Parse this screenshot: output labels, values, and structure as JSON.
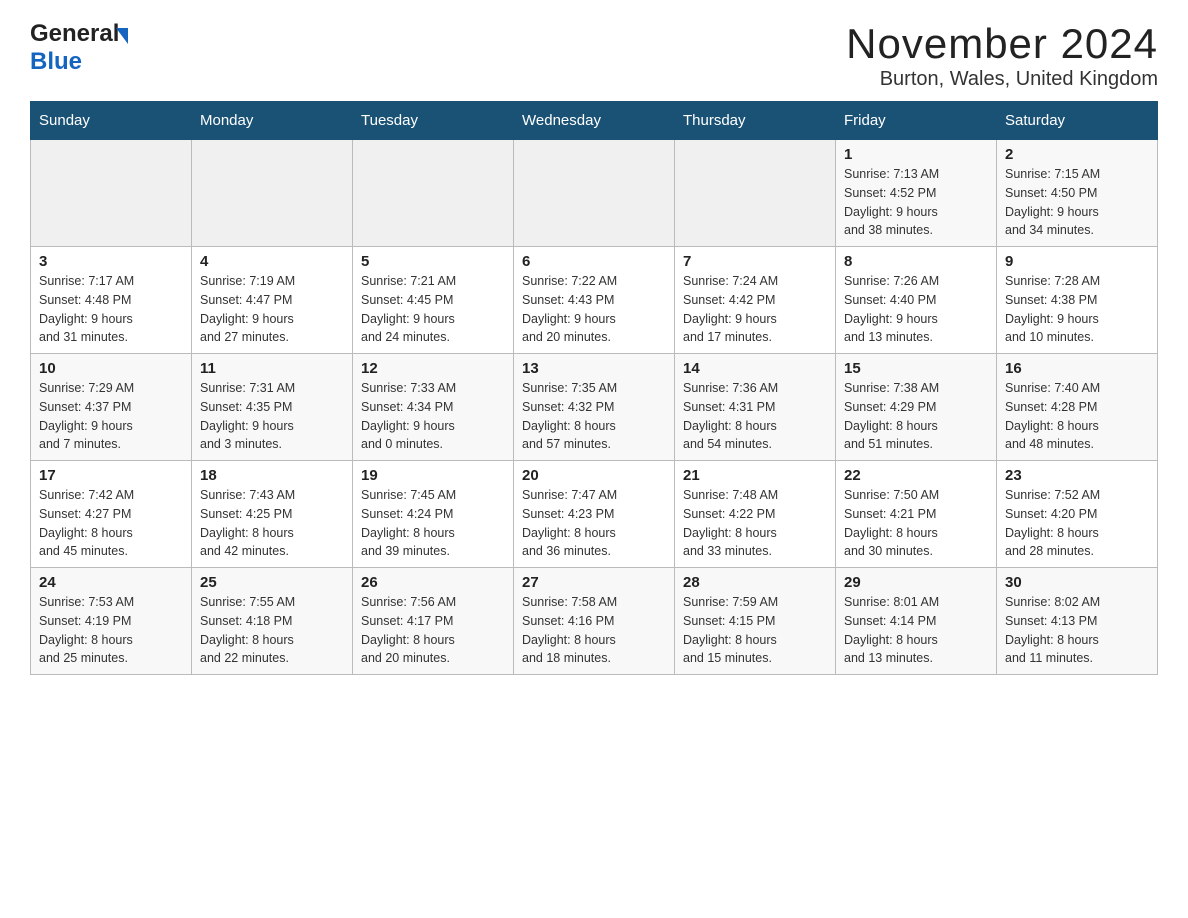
{
  "logo": {
    "general": "General",
    "blue": "Blue"
  },
  "title": "November 2024",
  "subtitle": "Burton, Wales, United Kingdom",
  "days_of_week": [
    "Sunday",
    "Monday",
    "Tuesday",
    "Wednesday",
    "Thursday",
    "Friday",
    "Saturday"
  ],
  "weeks": [
    {
      "days": [
        {
          "number": "",
          "info": ""
        },
        {
          "number": "",
          "info": ""
        },
        {
          "number": "",
          "info": ""
        },
        {
          "number": "",
          "info": ""
        },
        {
          "number": "",
          "info": ""
        },
        {
          "number": "1",
          "info": "Sunrise: 7:13 AM\nSunset: 4:52 PM\nDaylight: 9 hours\nand 38 minutes."
        },
        {
          "number": "2",
          "info": "Sunrise: 7:15 AM\nSunset: 4:50 PM\nDaylight: 9 hours\nand 34 minutes."
        }
      ]
    },
    {
      "days": [
        {
          "number": "3",
          "info": "Sunrise: 7:17 AM\nSunset: 4:48 PM\nDaylight: 9 hours\nand 31 minutes."
        },
        {
          "number": "4",
          "info": "Sunrise: 7:19 AM\nSunset: 4:47 PM\nDaylight: 9 hours\nand 27 minutes."
        },
        {
          "number": "5",
          "info": "Sunrise: 7:21 AM\nSunset: 4:45 PM\nDaylight: 9 hours\nand 24 minutes."
        },
        {
          "number": "6",
          "info": "Sunrise: 7:22 AM\nSunset: 4:43 PM\nDaylight: 9 hours\nand 20 minutes."
        },
        {
          "number": "7",
          "info": "Sunrise: 7:24 AM\nSunset: 4:42 PM\nDaylight: 9 hours\nand 17 minutes."
        },
        {
          "number": "8",
          "info": "Sunrise: 7:26 AM\nSunset: 4:40 PM\nDaylight: 9 hours\nand 13 minutes."
        },
        {
          "number": "9",
          "info": "Sunrise: 7:28 AM\nSunset: 4:38 PM\nDaylight: 9 hours\nand 10 minutes."
        }
      ]
    },
    {
      "days": [
        {
          "number": "10",
          "info": "Sunrise: 7:29 AM\nSunset: 4:37 PM\nDaylight: 9 hours\nand 7 minutes."
        },
        {
          "number": "11",
          "info": "Sunrise: 7:31 AM\nSunset: 4:35 PM\nDaylight: 9 hours\nand 3 minutes."
        },
        {
          "number": "12",
          "info": "Sunrise: 7:33 AM\nSunset: 4:34 PM\nDaylight: 9 hours\nand 0 minutes."
        },
        {
          "number": "13",
          "info": "Sunrise: 7:35 AM\nSunset: 4:32 PM\nDaylight: 8 hours\nand 57 minutes."
        },
        {
          "number": "14",
          "info": "Sunrise: 7:36 AM\nSunset: 4:31 PM\nDaylight: 8 hours\nand 54 minutes."
        },
        {
          "number": "15",
          "info": "Sunrise: 7:38 AM\nSunset: 4:29 PM\nDaylight: 8 hours\nand 51 minutes."
        },
        {
          "number": "16",
          "info": "Sunrise: 7:40 AM\nSunset: 4:28 PM\nDaylight: 8 hours\nand 48 minutes."
        }
      ]
    },
    {
      "days": [
        {
          "number": "17",
          "info": "Sunrise: 7:42 AM\nSunset: 4:27 PM\nDaylight: 8 hours\nand 45 minutes."
        },
        {
          "number": "18",
          "info": "Sunrise: 7:43 AM\nSunset: 4:25 PM\nDaylight: 8 hours\nand 42 minutes."
        },
        {
          "number": "19",
          "info": "Sunrise: 7:45 AM\nSunset: 4:24 PM\nDaylight: 8 hours\nand 39 minutes."
        },
        {
          "number": "20",
          "info": "Sunrise: 7:47 AM\nSunset: 4:23 PM\nDaylight: 8 hours\nand 36 minutes."
        },
        {
          "number": "21",
          "info": "Sunrise: 7:48 AM\nSunset: 4:22 PM\nDaylight: 8 hours\nand 33 minutes."
        },
        {
          "number": "22",
          "info": "Sunrise: 7:50 AM\nSunset: 4:21 PM\nDaylight: 8 hours\nand 30 minutes."
        },
        {
          "number": "23",
          "info": "Sunrise: 7:52 AM\nSunset: 4:20 PM\nDaylight: 8 hours\nand 28 minutes."
        }
      ]
    },
    {
      "days": [
        {
          "number": "24",
          "info": "Sunrise: 7:53 AM\nSunset: 4:19 PM\nDaylight: 8 hours\nand 25 minutes."
        },
        {
          "number": "25",
          "info": "Sunrise: 7:55 AM\nSunset: 4:18 PM\nDaylight: 8 hours\nand 22 minutes."
        },
        {
          "number": "26",
          "info": "Sunrise: 7:56 AM\nSunset: 4:17 PM\nDaylight: 8 hours\nand 20 minutes."
        },
        {
          "number": "27",
          "info": "Sunrise: 7:58 AM\nSunset: 4:16 PM\nDaylight: 8 hours\nand 18 minutes."
        },
        {
          "number": "28",
          "info": "Sunrise: 7:59 AM\nSunset: 4:15 PM\nDaylight: 8 hours\nand 15 minutes."
        },
        {
          "number": "29",
          "info": "Sunrise: 8:01 AM\nSunset: 4:14 PM\nDaylight: 8 hours\nand 13 minutes."
        },
        {
          "number": "30",
          "info": "Sunrise: 8:02 AM\nSunset: 4:13 PM\nDaylight: 8 hours\nand 11 minutes."
        }
      ]
    }
  ]
}
